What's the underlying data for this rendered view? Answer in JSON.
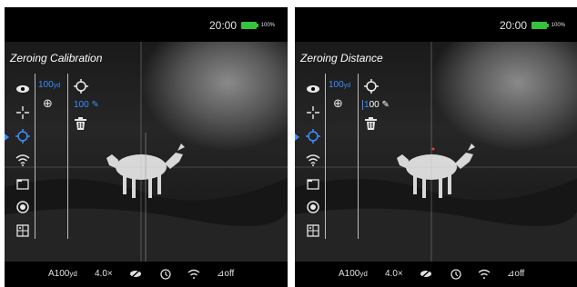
{
  "screens": [
    {
      "status": {
        "time": "20:00",
        "battery_percent": "100%"
      },
      "menu_title": "Zeroing Calibration",
      "sidebar": {
        "items": [
          {
            "icon": "eye-icon"
          },
          {
            "icon": "crosshair-icon"
          },
          {
            "icon": "zeroing-target-icon",
            "active": true
          },
          {
            "icon": "wifi-icon"
          },
          {
            "icon": "folder-icon"
          },
          {
            "icon": "record-icon"
          },
          {
            "icon": "settings-grid-icon"
          }
        ]
      },
      "submenu": {
        "distance_value": "100",
        "distance_unit": "yd",
        "add_label": "⊕",
        "edit_value": "100",
        "delete_label": "delete"
      },
      "bottom_bar": {
        "profile": "A100",
        "profile_unit": "yd",
        "zoom": "4.0×",
        "ir_state": "off",
        "pip_state": "off"
      }
    },
    {
      "status": {
        "time": "20:00",
        "battery_percent": "100%"
      },
      "menu_title": "Zeroing Distance",
      "submenu": {
        "distance_value": "100",
        "distance_unit": "yd",
        "edit_first_digit": "1",
        "edit_rest": "00"
      },
      "bottom_bar": {
        "profile": "A100",
        "profile_unit": "yd",
        "zoom": "4.0×",
        "pip_state": "off"
      }
    }
  ],
  "accent_color": "#3a8dff",
  "battery_color": "#33c43c"
}
